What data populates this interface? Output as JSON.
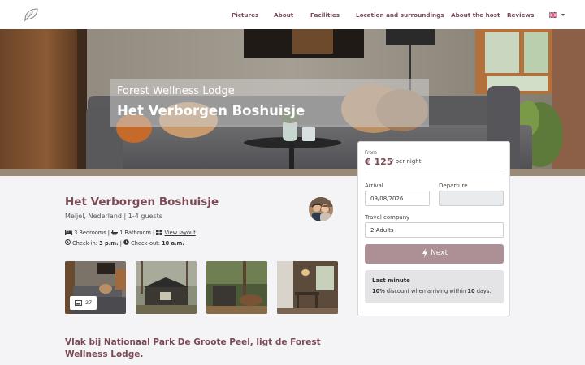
{
  "nav": {
    "logo_icon": "leaf-icon",
    "links": [
      "Pictures",
      "About",
      "Facilities",
      "Location and surroundings",
      "About the host",
      "Reviews"
    ],
    "language_icon": "uk-flag-icon"
  },
  "hero": {
    "subtitle": "Forest Wellness Lodge",
    "title": "Het Verborgen Boshuisje"
  },
  "booking": {
    "from_label": "From",
    "price": "€ 125",
    "per_night": "/ per night",
    "arrival_label": "Arrival",
    "arrival_value": "09/08/2026",
    "departure_label": "Departure",
    "departure_value": "",
    "company_label": "Travel company",
    "company_value": "2 Adults",
    "next_label": "Next",
    "last_minute_title": "Last minute",
    "last_minute_pct": "10%",
    "last_minute_mid": " discount when arriving within ",
    "last_minute_days": "10",
    "last_minute_end": " days."
  },
  "listing": {
    "title": "Het Verborgen Boshuisje",
    "location": "Meijel, Nederland | 1-4 guests",
    "bedrooms": "3 Bedrooms",
    "bathrooms": "1 Bathroom",
    "view_layout": "View layout",
    "checkin_label": "Check-in:",
    "checkin_time": "3 p.m.",
    "checkout_label": "Check-out:",
    "checkout_time": "10 a.m.",
    "photo_count": "27",
    "description_heading": "Vlak bij Nationaal Park De Groote Peel, ligt de Forest Wellness Lodge."
  },
  "colors": {
    "accent": "#7a4a55",
    "button": "#ad9096",
    "background": "#f4f3f6"
  }
}
